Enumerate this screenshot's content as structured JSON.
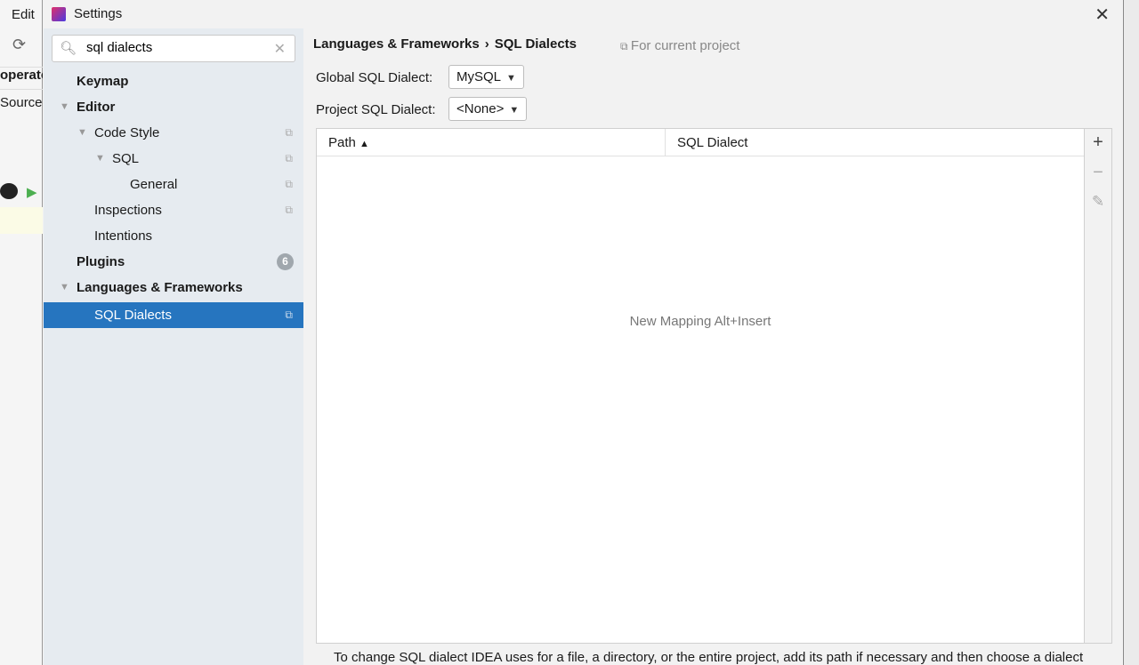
{
  "background": {
    "menu_edit": "Edit",
    "tab1": "operato",
    "tab2": "SourceU"
  },
  "dialog": {
    "title": "Settings"
  },
  "search": {
    "value": "sql dialects"
  },
  "tree": [
    {
      "label": "Keymap",
      "bold": true
    },
    {
      "label": "Editor",
      "bold": true
    },
    {
      "label": "Code Style"
    },
    {
      "label": "SQL"
    },
    {
      "label": "General"
    },
    {
      "label": "Inspections"
    },
    {
      "label": "Intentions"
    },
    {
      "label": "Plugins",
      "bold": true,
      "badge": "6"
    },
    {
      "label": "Languages & Frameworks",
      "bold": true
    },
    {
      "label": "SQL Dialects",
      "selected": true
    }
  ],
  "breadcrumb": {
    "parent": "Languages & Frameworks",
    "sep": "›",
    "current": "SQL Dialects"
  },
  "scope": "For current project",
  "global": {
    "label": "Global SQL Dialect:",
    "value": "MySQL"
  },
  "project": {
    "label": "Project SQL Dialect:",
    "value": "<None>"
  },
  "table": {
    "columns": [
      "Path",
      "SQL Dialect"
    ],
    "sort_indicator": "▲",
    "empty_text": "New Mapping Alt+Insert"
  },
  "footer": "To change SQL dialect IDEA uses for a file, a directory, or the entire project, add its path if necessary and then choose a dialect"
}
